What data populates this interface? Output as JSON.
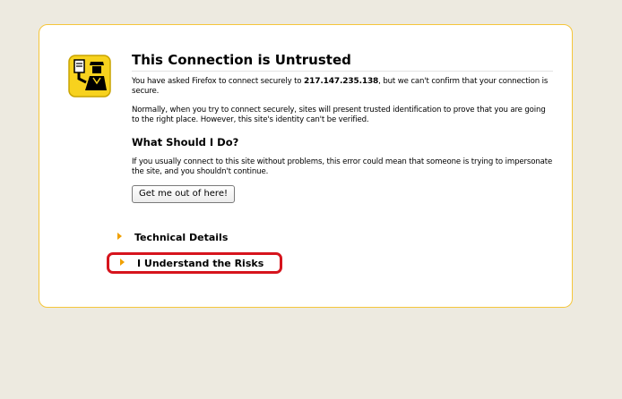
{
  "error_page": {
    "title": "This Connection is Untrusted",
    "intro_before": "You have asked Firefox to connect securely to ",
    "host": "217.147.235.138",
    "intro_after": ", but we can't confirm that your connection is secure.",
    "explanation": "Normally, when you try to connect securely, sites will present trusted identification to prove that you are going to the right place. However, this site's identity can't be verified.",
    "what_heading": "What Should I Do?",
    "advice": "If you usually connect to this site without problems, this error could mean that someone is trying to impersonate the site, and you shouldn't continue.",
    "get_out_button": "Get me out of here!",
    "technical_details": "Technical Details",
    "understand_risks": "I Understand the Risks"
  },
  "colors": {
    "page_background": "#edeae0",
    "box_border": "#f5c63a",
    "icon_yellow": "#f7d21e",
    "arrow": "#f0a000",
    "highlight": "#d6141d"
  },
  "icons": {
    "warning": "policeman-warning-icon",
    "expander": "triangle-right-icon"
  }
}
